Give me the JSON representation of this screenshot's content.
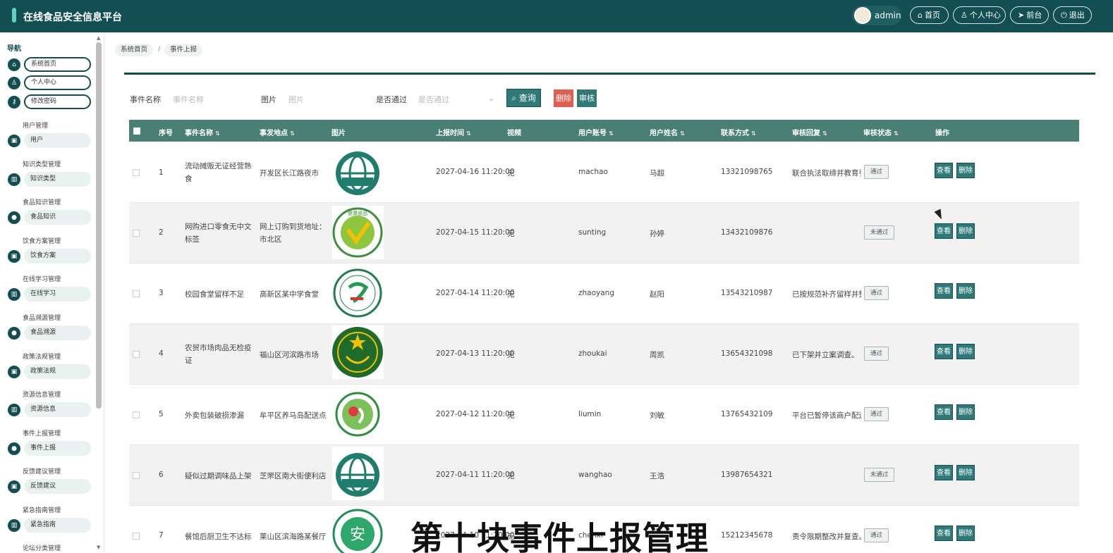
{
  "app": {
    "title": "在线食品安全信息平台"
  },
  "header": {
    "user": "admin",
    "home": "首页",
    "profile": "个人中心",
    "front": "前台",
    "logout": "退出"
  },
  "colors": {
    "primary": "#134f52",
    "table_header": "#4a7f74",
    "action_button": "#2f7a79",
    "delete_button": "#e25f4f"
  },
  "sidebar": {
    "nav_label": "导航",
    "top_items": [
      {
        "label": "系统首页",
        "icon": "home-icon"
      },
      {
        "label": "个人中心",
        "icon": "user-icon"
      },
      {
        "label": "修改密码",
        "icon": "key-icon"
      }
    ],
    "groups": [
      {
        "header": "用户管理",
        "item": "用户",
        "icon": "briefcase-icon"
      },
      {
        "header": "知识类型管理",
        "item": "知识类型",
        "icon": "chart-icon"
      },
      {
        "header": "食品知识管理",
        "item": "食品知识",
        "icon": "location-icon"
      },
      {
        "header": "饮食方案管理",
        "item": "饮食方案",
        "icon": "briefcase-icon"
      },
      {
        "header": "在线学习管理",
        "item": "在线学习",
        "icon": "chart-icon"
      },
      {
        "header": "食品溯源管理",
        "item": "食品溯源",
        "icon": "location-icon"
      },
      {
        "header": "政策法规管理",
        "item": "政策法规",
        "icon": "briefcase-icon"
      },
      {
        "header": "资源信息管理",
        "item": "资源信息",
        "icon": "chart-icon"
      },
      {
        "header": "事件上报管理",
        "item": "事件上报",
        "icon": "location-icon"
      },
      {
        "header": "反馈建议管理",
        "item": "反馈建议",
        "icon": "briefcase-icon"
      },
      {
        "header": "紧急指南管理",
        "item": "紧急指南",
        "icon": "chart-icon"
      },
      {
        "header": "论坛分类管理",
        "item": "",
        "icon": ""
      }
    ]
  },
  "breadcrumb": [
    "系统首页",
    "事件上报"
  ],
  "search": {
    "name_label": "事件名称",
    "name_placeholder": "事件名称",
    "pic_label": "图片",
    "pic_placeholder": "图片",
    "pass_label": "是否通过",
    "pass_placeholder": "是否通过",
    "query_label": "查询",
    "delete_label": "删除",
    "audit_label": "审核"
  },
  "table": {
    "columns": [
      "序号",
      "事件名称",
      "事发地点",
      "图片",
      "上报时间",
      "视频",
      "用户账号",
      "用户姓名",
      "联系方式",
      "审核回复",
      "审核状态",
      "操作"
    ],
    "rows": [
      {
        "no": "1",
        "name": "流动摊贩无证经营熟食",
        "place": "开发区长江路夜市",
        "image": "iso22000-logo",
        "time": "2027-04-16 11:20:00",
        "video": "无",
        "account": "machao",
        "realname": "马超",
        "phone": "13321098765",
        "reply": "联合执法取缔并教育引导",
        "status": "通过"
      },
      {
        "no": "2",
        "name": "网购进口零食无中文标签",
        "place": "网上订购到货地址：市北区",
        "image": "green-food-logo",
        "time": "2027-04-15 11:20:00",
        "video": "无",
        "account": "sunting",
        "realname": "孙婷",
        "phone": "13432109876",
        "reply": "",
        "status": "未通过"
      },
      {
        "no": "3",
        "name": "校园食堂留样不足",
        "place": "高新区某中学食堂",
        "image": "food-safety-logo",
        "time": "2027-04-14 11:20:00",
        "video": "无",
        "account": "zhaoyang",
        "realname": "赵阳",
        "phone": "13543210987",
        "reply": "已按规范补齐留样并整改",
        "status": "通过"
      },
      {
        "no": "4",
        "name": "农贸市场肉品无检疫证",
        "place": "福山区河滨路市场",
        "image": "inspection-emblem",
        "time": "2027-04-13 11:20:00",
        "video": "无",
        "account": "zhoukai",
        "realname": "周凯",
        "phone": "13654321098",
        "reply": "已下架并立案调查。",
        "status": "通过"
      },
      {
        "no": "5",
        "name": "外卖包装破损渗漏",
        "place": "牟平区养马岛配送点",
        "image": "safety-seal-logo",
        "time": "2027-04-12 11:20:00",
        "video": "无",
        "account": "liumin",
        "realname": "刘敏",
        "phone": "13765432109",
        "reply": "平台已暂停该商户配送",
        "status": "通过"
      },
      {
        "no": "6",
        "name": "疑似过期调味品上架",
        "place": "芝罘区南大街便利店",
        "image": "iso22000-logo",
        "time": "2027-04-11 11:20:00",
        "video": "无",
        "account": "wanghao",
        "realname": "王浩",
        "phone": "13987654321",
        "reply": "",
        "status": "未通过"
      },
      {
        "no": "7",
        "name": "餐馆后厨卫生不达标",
        "place": "莱山区滨海路某餐厅",
        "image": "an-safety-logo",
        "time": "2027-04-10 11:20:00",
        "video": "无",
        "account": "chenxi",
        "realname": "",
        "phone": "15212345678",
        "reply": "责令限期整改并复查。",
        "status": "通过"
      }
    ],
    "view_label": "查看",
    "delete_label": "删除"
  },
  "overlay_caption": "第十块事件上报管理"
}
